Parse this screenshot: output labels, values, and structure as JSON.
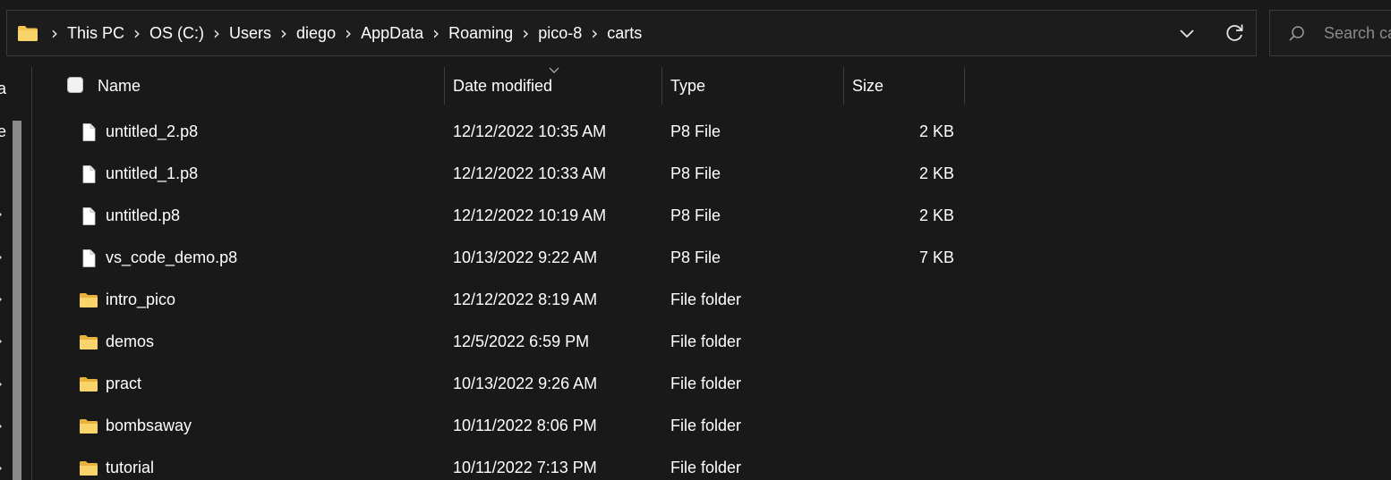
{
  "address_bar": {
    "breadcrumbs": [
      "This PC",
      "OS (C:)",
      "Users",
      "diego",
      "AppData",
      "Roaming",
      "pico-8",
      "carts"
    ],
    "separator": "›"
  },
  "search": {
    "placeholder": "Search carts"
  },
  "nav_pane": {
    "visible_fragments": [
      "a",
      "e"
    ]
  },
  "columns": {
    "name": "Name",
    "date_modified": "Date modified",
    "type": "Type",
    "size": "Size"
  },
  "files": [
    {
      "name": "untitled_2.p8",
      "date": "12/12/2022 10:35 AM",
      "type": "P8 File",
      "size": "2 KB",
      "icon": "file-icon"
    },
    {
      "name": "untitled_1.p8",
      "date": "12/12/2022 10:33 AM",
      "type": "P8 File",
      "size": "2 KB",
      "icon": "file-icon"
    },
    {
      "name": "untitled.p8",
      "date": "12/12/2022 10:19 AM",
      "type": "P8 File",
      "size": "2 KB",
      "icon": "file-icon"
    },
    {
      "name": "vs_code_demo.p8",
      "date": "10/13/2022 9:22 AM",
      "type": "P8 File",
      "size": "7 KB",
      "icon": "file-icon"
    },
    {
      "name": "intro_pico",
      "date": "12/12/2022 8:19 AM",
      "type": "File folder",
      "size": "",
      "icon": "folder-icon"
    },
    {
      "name": "demos",
      "date": "12/5/2022 6:59 PM",
      "type": "File folder",
      "size": "",
      "icon": "folder-icon"
    },
    {
      "name": "pract",
      "date": "10/13/2022 9:26 AM",
      "type": "File folder",
      "size": "",
      "icon": "folder-icon"
    },
    {
      "name": "bombsaway",
      "date": "10/11/2022 8:06 PM",
      "type": "File folder",
      "size": "",
      "icon": "folder-icon"
    },
    {
      "name": "tutorial",
      "date": "10/11/2022 7:13 PM",
      "type": "File folder",
      "size": "",
      "icon": "folder-icon"
    }
  ],
  "colors": {
    "background": "#191919",
    "folder_yellow": "#f3c44f",
    "file_white": "#ffffff",
    "scrollbar": "#8a8a8a"
  }
}
